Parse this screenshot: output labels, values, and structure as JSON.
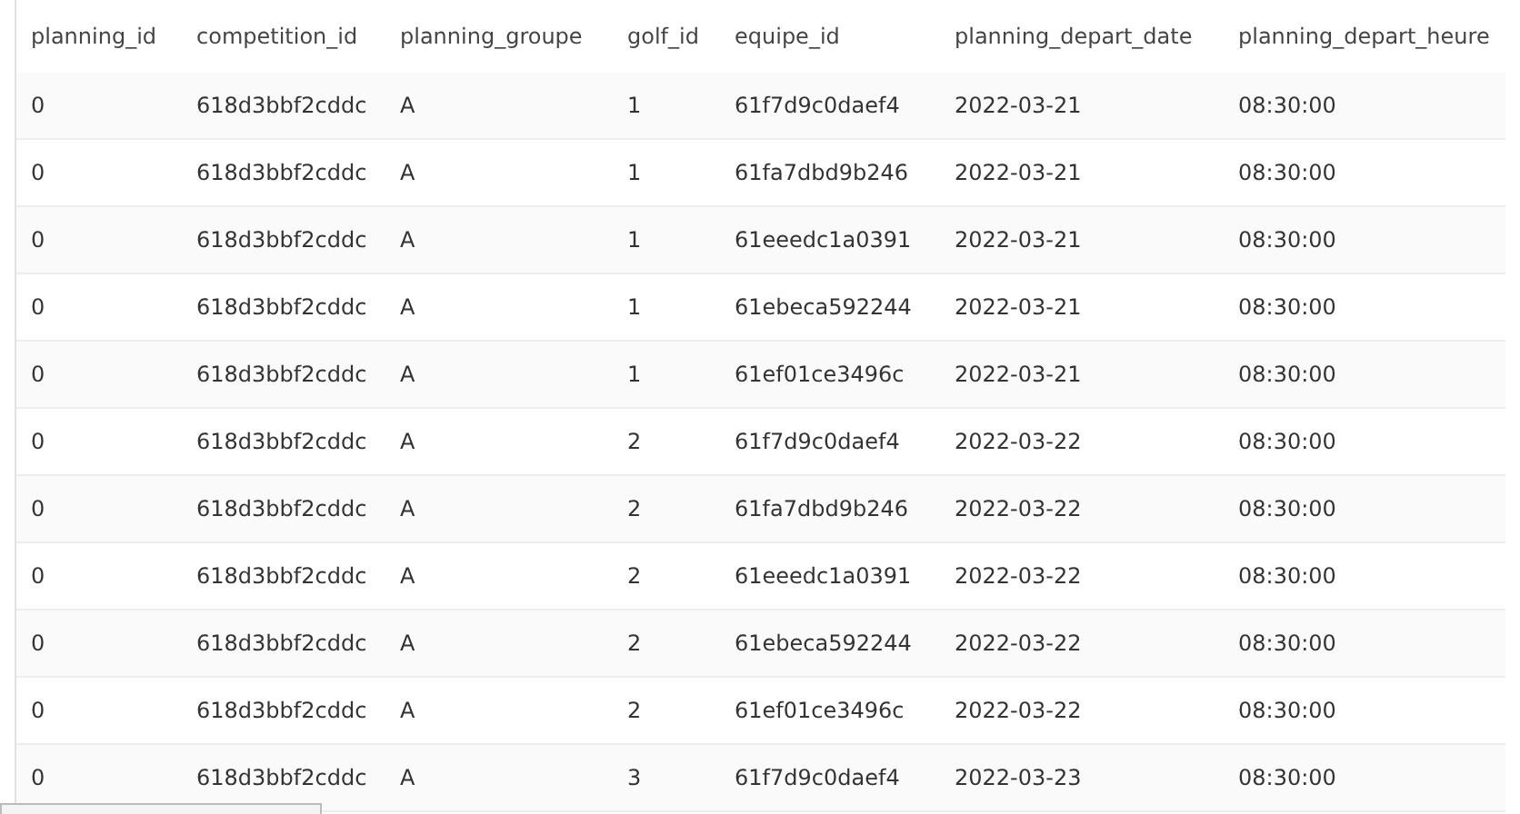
{
  "table": {
    "columns": [
      "planning_id",
      "competition_id",
      "planning_groupe",
      "golf_id",
      "equipe_id",
      "planning_depart_date",
      "planning_depart_heure"
    ],
    "rows": [
      [
        "0",
        "618d3bbf2cddc",
        "A",
        "1",
        "61f7d9c0daef4",
        "2022-03-21",
        "08:30:00"
      ],
      [
        "0",
        "618d3bbf2cddc",
        "A",
        "1",
        "61fa7dbd9b246",
        "2022-03-21",
        "08:30:00"
      ],
      [
        "0",
        "618d3bbf2cddc",
        "A",
        "1",
        "61eeedc1a0391",
        "2022-03-21",
        "08:30:00"
      ],
      [
        "0",
        "618d3bbf2cddc",
        "A",
        "1",
        "61ebeca592244",
        "2022-03-21",
        "08:30:00"
      ],
      [
        "0",
        "618d3bbf2cddc",
        "A",
        "1",
        "61ef01ce3496c",
        "2022-03-21",
        "08:30:00"
      ],
      [
        "0",
        "618d3bbf2cddc",
        "A",
        "2",
        "61f7d9c0daef4",
        "2022-03-22",
        "08:30:00"
      ],
      [
        "0",
        "618d3bbf2cddc",
        "A",
        "2",
        "61fa7dbd9b246",
        "2022-03-22",
        "08:30:00"
      ],
      [
        "0",
        "618d3bbf2cddc",
        "A",
        "2",
        "61eeedc1a0391",
        "2022-03-22",
        "08:30:00"
      ],
      [
        "0",
        "618d3bbf2cddc",
        "A",
        "2",
        "61ebeca592244",
        "2022-03-22",
        "08:30:00"
      ],
      [
        "0",
        "618d3bbf2cddc",
        "A",
        "2",
        "61ef01ce3496c",
        "2022-03-22",
        "08:30:00"
      ],
      [
        "0",
        "618d3bbf2cddc",
        "A",
        "3",
        "61f7d9c0daef4",
        "2022-03-23",
        "08:30:00"
      ]
    ]
  }
}
